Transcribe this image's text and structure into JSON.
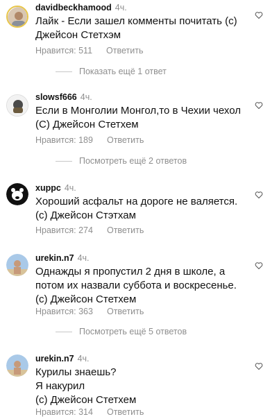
{
  "comments": [
    {
      "author": "davidbeckhamood",
      "time": "4ч.",
      "lines": [
        "Лайк - Если зашел комменты почитать (с)",
        "Джейсон Стетхэм"
      ],
      "likes": "Нравится: 511",
      "reply": "Ответить",
      "more": "Показать ещё 1 ответ"
    },
    {
      "author": "slowsf666",
      "time": "4ч.",
      "lines": [
        "Если в Монголии Монгол,то в Чехии чехол",
        "(С) Джейсон Стетхем"
      ],
      "likes": "Нравится: 189",
      "reply": "Ответить",
      "more": "Посмотреть ещё 2 ответов"
    },
    {
      "author": "xuppc",
      "time": "4ч.",
      "lines": [
        "Хороший асфальт на дороге не валяется.",
        "(с) Джейсон Стэтхам"
      ],
      "likes": "Нравится: 274",
      "reply": "Ответить"
    },
    {
      "author": "urekin.n7",
      "time": "4ч.",
      "lines": [
        "Однажды я пропустил 2 дня в школе, а",
        "потом их назвали суббота и воскресенье.",
        "(с) Джейсон Стетхем"
      ],
      "likes": "Нравится: 363",
      "reply": "Ответить",
      "more": "Посмотреть ещё 5 ответов"
    },
    {
      "author": "urekin.n7",
      "time": "4ч.",
      "lines": [
        "Курилы знаешь?",
        "Я накурил",
        "(с) Джейсон Стетхем"
      ],
      "likes": "Нравится: 314",
      "reply": "Ответить"
    }
  ],
  "icons": {
    "like": "heart-outline-icon"
  }
}
